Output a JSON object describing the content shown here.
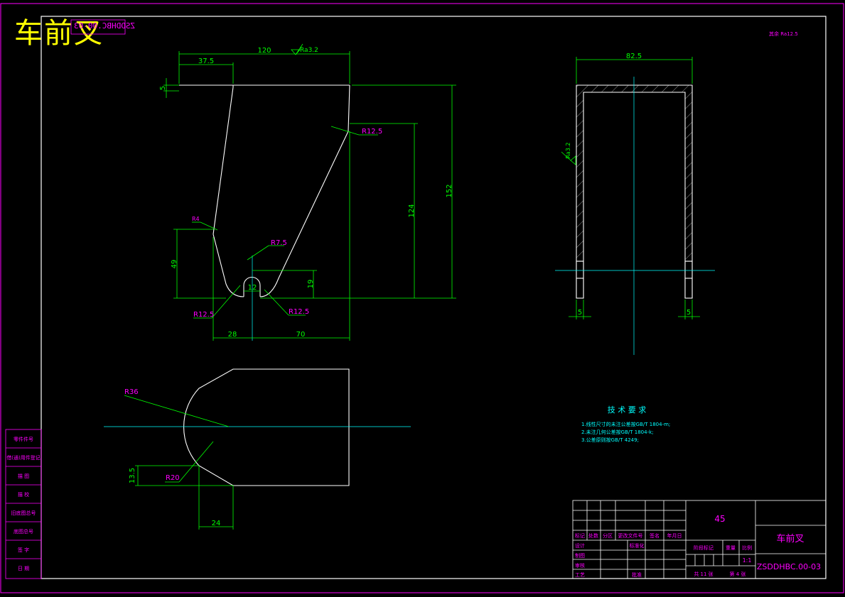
{
  "header": {
    "title": "车前叉",
    "mirrored_code": "ZSDDHBC.00-03"
  },
  "dimensions": {
    "w_120": "120",
    "w_37_5": "37.5",
    "h_5": "5",
    "ra_top": "Ra3.2",
    "r_12_5_top": "R12.5",
    "h_152": "152",
    "h_124": "124",
    "r_4": "R4",
    "h_49": "49",
    "r_7_5": "R7.5",
    "w_12": "12",
    "h_19": "19",
    "r_12_5_left": "R12.5",
    "r_12_5_right": "R12.5",
    "w_28": "28",
    "w_70": "70",
    "w_82_5": "82.5",
    "ra_side": "Ra3.2",
    "w_5_left": "5",
    "w_5_right": "5",
    "r_36": "R36",
    "r_20": "R20",
    "h_13_5": "13.5",
    "w_24": "24",
    "roughness_note": "其余 Ra12.5"
  },
  "tech_requirements": {
    "title": "技 术 要 求",
    "items": [
      "1.线性尺寸的未注公差按GB/T 1804-m;",
      "2.未注几何公差按GB/T 1804-k;",
      "3.公差原则按GB/T 4249;"
    ]
  },
  "side_labels": [
    "零件件号",
    "借(通)用件登记",
    "描 图",
    "描 校",
    "旧底图总号",
    "底图总号",
    "签 字",
    "日 期"
  ],
  "title_block": {
    "material": "45",
    "part_name": "车前叉",
    "drawing_number": "ZSDDHBC.00-03",
    "scale": "1:1",
    "row_labels": [
      "标记",
      "处数",
      "分区",
      "更改文件号",
      "签名",
      "年月日"
    ],
    "designer": "设计",
    "standardize": "标准化",
    "drawer": "制图",
    "reviewer": "审核",
    "process": "工艺",
    "approve": "批准",
    "stage_mark": "阶段标记",
    "weight": "重量",
    "ratio": "比例",
    "total_sheets": "共 11 张",
    "sheet_no": "第 4 张"
  },
  "colors": {
    "border": "#ff00ff",
    "outline": "#ffffff",
    "dimension": "#00ff00",
    "center_line": "#00ffff",
    "title": "#ffff00"
  }
}
